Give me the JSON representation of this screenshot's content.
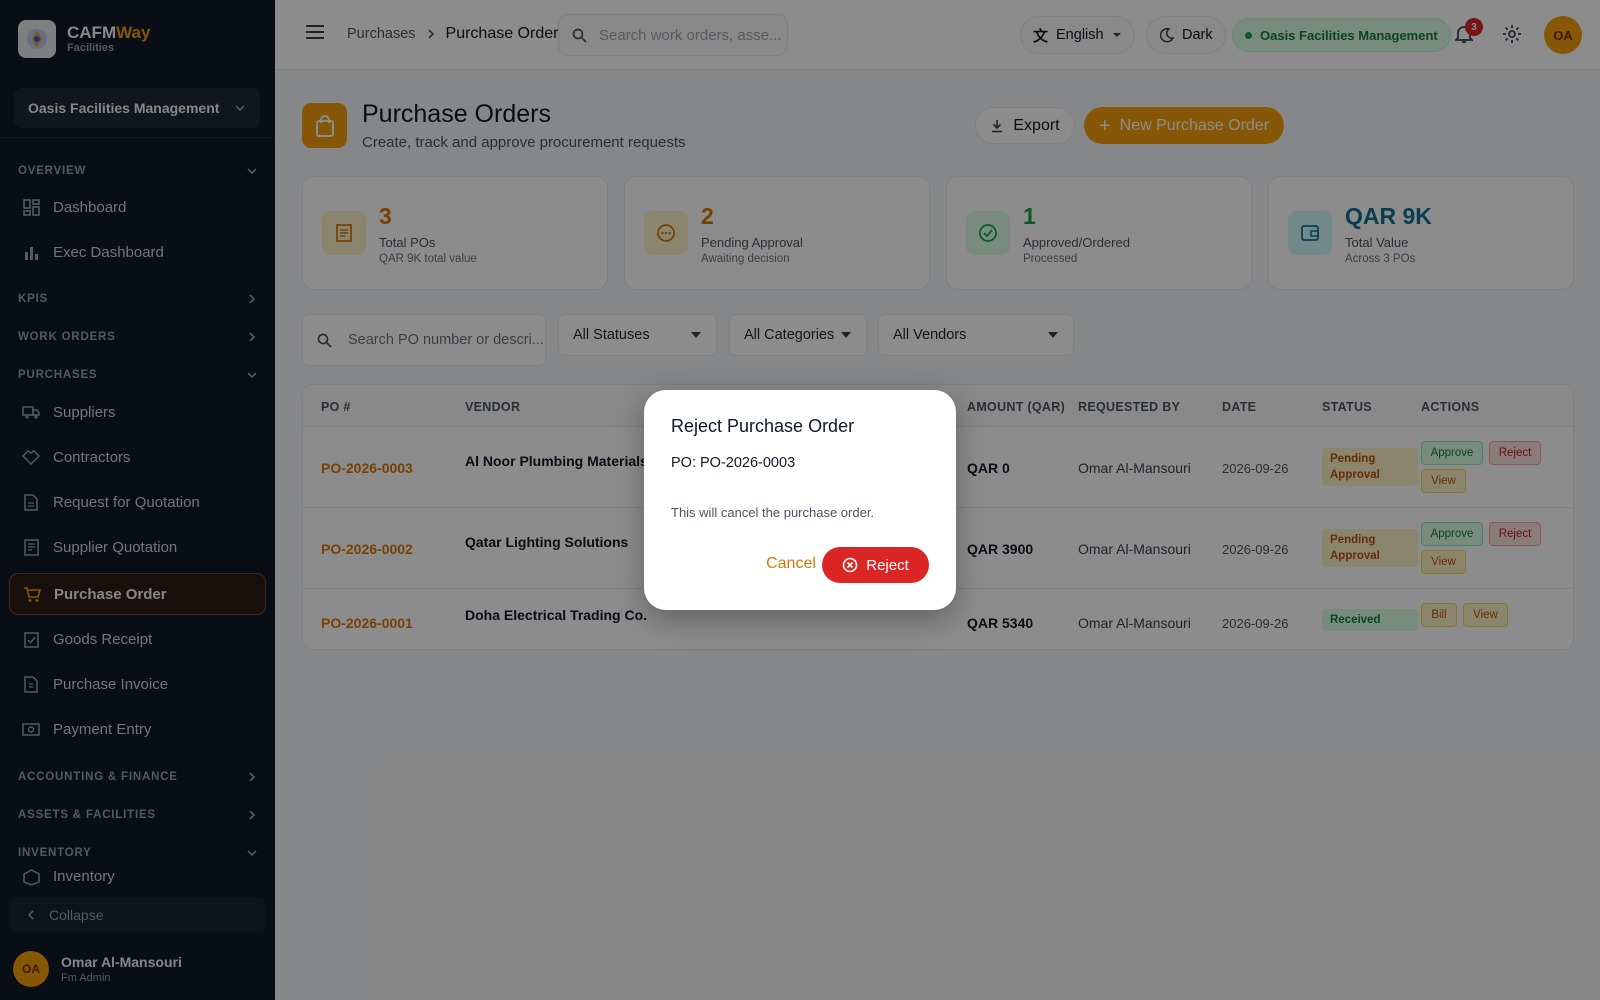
{
  "brand": {
    "name_main": "CAFM",
    "name_accent": "Way",
    "subtitle": "Facilities"
  },
  "sidebar": {
    "org": "Oasis Facilities Management",
    "sections": {
      "overview": "OVERVIEW",
      "kpis": "KPIS",
      "work_orders": "WORK ORDERS",
      "purchases": "PURCHASES",
      "accounting": "ACCOUNTING & FINANCE",
      "assets": "ASSETS & FACILITIES",
      "inventory": "INVENTORY"
    },
    "items": {
      "dashboard": "Dashboard",
      "exec_dashboard": "Exec Dashboard",
      "suppliers": "Suppliers",
      "contractors": "Contractors",
      "rfq": "Request for Quotation",
      "supplier_quotation": "Supplier Quotation",
      "purchase_order": "Purchase Order",
      "goods_receipt": "Goods Receipt",
      "purchase_invoice": "Purchase Invoice",
      "payment_entry": "Payment Entry",
      "inventory": "Inventory"
    },
    "collapse": "Collapse",
    "user": {
      "initials": "OA",
      "name": "Omar Al-Mansouri",
      "role": "Fm Admin"
    }
  },
  "topbar": {
    "breadcrumb_parent": "Purchases",
    "breadcrumb_current": "Purchase Order",
    "search_placeholder": "Search work orders, asse...",
    "language": "English",
    "theme": "Dark",
    "org": "Oasis Facilities Management",
    "notification_count": "3",
    "avatar_initials": "OA"
  },
  "page": {
    "title": "Purchase Orders",
    "subtitle": "Create, track and approve procurement requests",
    "export_label": "Export",
    "new_label": "New Purchase Order"
  },
  "stats": [
    {
      "value": "3",
      "label": "Total POs",
      "hint": "QAR 9K total value",
      "color": "#d97706"
    },
    {
      "value": "2",
      "label": "Pending Approval",
      "hint": "Awaiting decision",
      "color": "#d97706"
    },
    {
      "value": "1",
      "label": "Approved/Ordered",
      "hint": "Processed",
      "color": "#16a34a"
    },
    {
      "value": "QAR 9K",
      "label": "Total Value",
      "hint": "Across 3 POs",
      "color": "#0e7490"
    }
  ],
  "filters": {
    "search_placeholder": "Search PO number or descri...",
    "status": "All Statuses",
    "category": "All Categories",
    "vendor": "All Vendors"
  },
  "table": {
    "headers": {
      "po": "PO #",
      "vendor": "VENDOR",
      "amount": "AMOUNT (QAR)",
      "requested_by": "REQUESTED BY",
      "date": "DATE",
      "status": "STATUS",
      "actions": "ACTIONS"
    },
    "rows": [
      {
        "po": "PO-2026-0003",
        "vendor": "Al Noor Plumbing Materials",
        "amount": "QAR 0",
        "requested_by": "Omar Al-Mansouri",
        "date": "2026-09-26",
        "status": "Pending Approval",
        "a1": "Approve",
        "a2": "Reject",
        "a3": "View"
      },
      {
        "po": "PO-2026-0002",
        "vendor": "Qatar Lighting Solutions",
        "amount": "QAR 3900",
        "requested_by": "Omar Al-Mansouri",
        "date": "2026-09-26",
        "status": "Pending Approval",
        "a1": "Approve",
        "a2": "Reject",
        "a3": "View"
      },
      {
        "po": "PO-2026-0001",
        "vendor": "Doha Electrical Trading Co.",
        "amount": "QAR 5340",
        "requested_by": "Omar Al-Mansouri",
        "date": "2026-09-26",
        "status": "Received",
        "a1": "Bill",
        "a3": "View"
      }
    ]
  },
  "modal": {
    "title": "Reject Purchase Order",
    "po_line": "PO: PO-2026-0003",
    "body": "This will cancel the purchase order.",
    "cancel": "Cancel",
    "confirm": "Reject"
  }
}
